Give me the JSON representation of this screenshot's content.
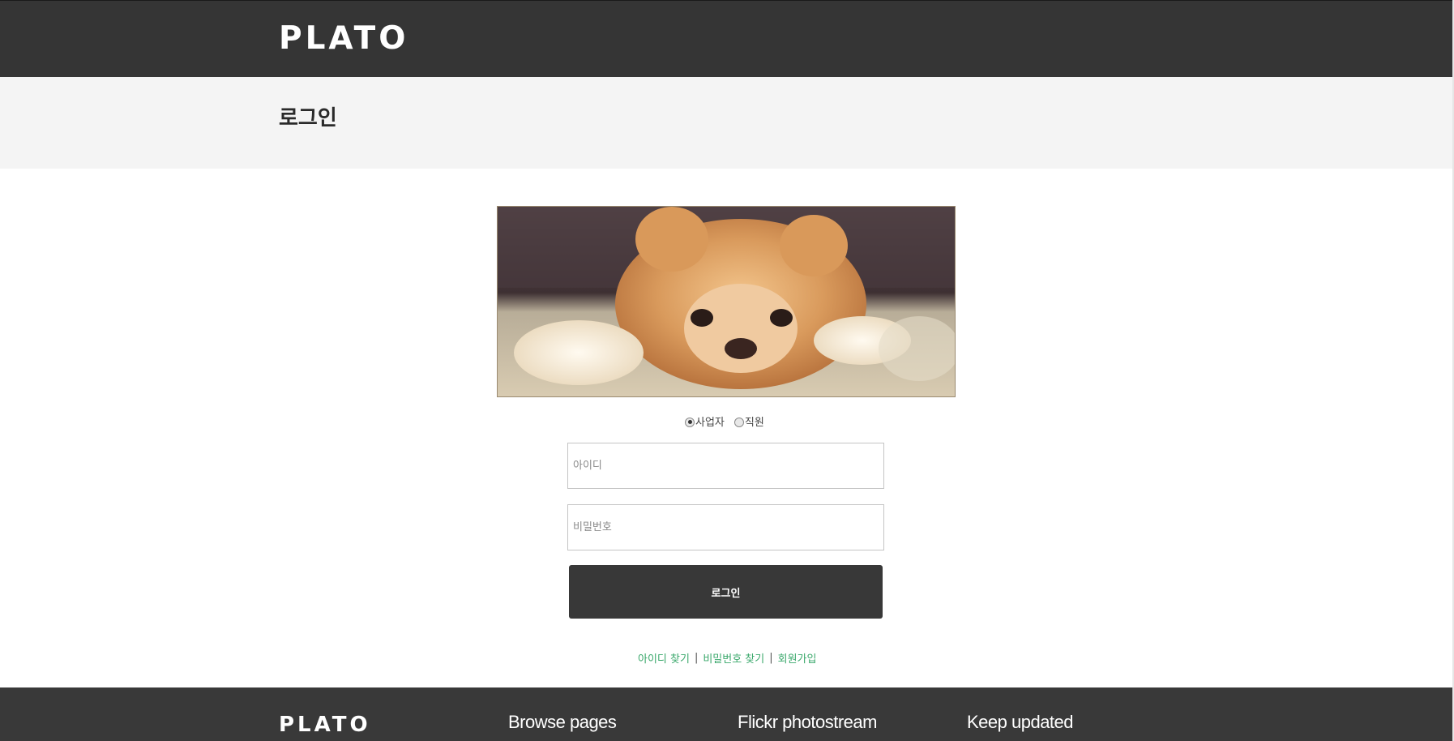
{
  "header": {
    "brand": "PLATO"
  },
  "title_band": {
    "title": "로그인"
  },
  "login": {
    "hero_image": "pomeranian-puppy-photo",
    "roles": [
      {
        "label": "사업자",
        "checked": true
      },
      {
        "label": "직원",
        "checked": false
      }
    ],
    "id_placeholder": "아이디",
    "password_placeholder": "비밀번호",
    "submit_label": "로그인",
    "links": {
      "find_id": "아이디 찾기",
      "find_password": "비밀번호 찾기",
      "signup": "회원가입",
      "separator": "|"
    },
    "link_color": "#3aa86b"
  },
  "footer": {
    "brand": "PLATO",
    "columns": [
      "Browse pages",
      "Flickr photostream",
      "Keep updated"
    ]
  },
  "colors": {
    "header_bg": "#353535",
    "title_band_bg": "#f4f4f4",
    "button_bg": "#383838",
    "footer_bg": "#393939"
  }
}
